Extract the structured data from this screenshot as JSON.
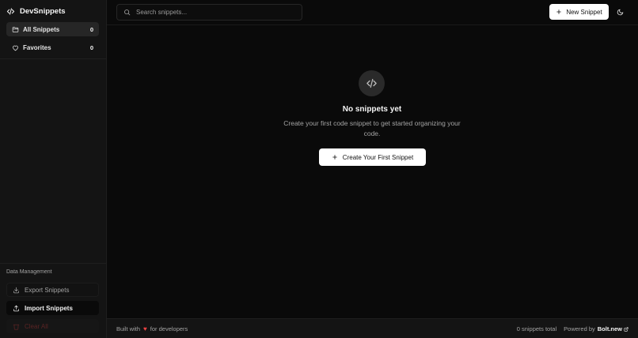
{
  "sidebar": {
    "brand": "DevSnippets",
    "nav": [
      {
        "label": "All Snippets",
        "count": "0",
        "icon": "folder-icon"
      },
      {
        "label": "Favorites",
        "count": "0",
        "icon": "heart-icon"
      }
    ],
    "data_management": {
      "label": "Data Management",
      "export_label": "Export Snippets",
      "import_label": "Import Snippets",
      "clear_label": "Clear All"
    }
  },
  "header": {
    "search_placeholder": "Search snippets...",
    "new_button_label": "New Snippet",
    "theme_toggle_icon": "moon-icon"
  },
  "empty_state": {
    "title": "No snippets yet",
    "description": "Create your first code snippet to get started organizing your code.",
    "button_label": "Create Your First Snippet"
  },
  "footer": {
    "built_with": "Built with",
    "for_developers": "for developers",
    "total": "0 snippets total",
    "powered_by": "Powered by",
    "bolt": "Bolt.new"
  },
  "colors": {
    "background": "#0a0a0a",
    "sidebar": "#141414",
    "accent_button": "#ffffff",
    "heart": "#ef4444"
  }
}
